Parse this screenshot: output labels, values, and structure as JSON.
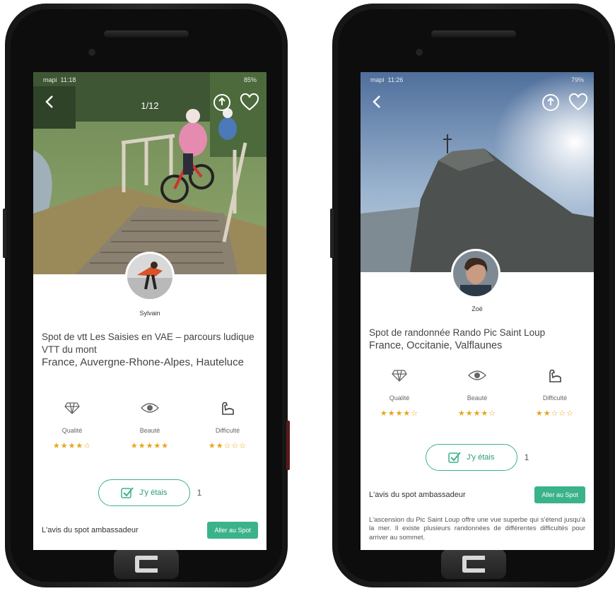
{
  "colors": {
    "accent": "#3bb38a",
    "star": "#e6a619",
    "text": "#444444"
  },
  "left": {
    "status": {
      "carrier": "mapi",
      "time": "11:18",
      "battery": "85%"
    },
    "photo_counter": "1/12",
    "author": "Sylvain",
    "title_line1": "Spot de vtt Les Saisies en VAE – parcours ludique VTT du mont",
    "title_line2": "France, Auvergne-Rhone-Alpes, Hauteluce",
    "ratings": [
      {
        "label": "Qualité",
        "stars": "★★★★☆",
        "value": 4,
        "icon": "diamond-icon"
      },
      {
        "label": "Beauté",
        "stars": "★★★★★",
        "value": 5,
        "icon": "eye-icon"
      },
      {
        "label": "Difficulté",
        "stars": "★★☆☆☆",
        "value": 2,
        "icon": "muscle-icon"
      }
    ],
    "been_label": "J'y étais",
    "been_count": "1",
    "ambassador_label": "L'avis du spot ambassadeur",
    "go_label": "Aller au Spot"
  },
  "right": {
    "status": {
      "carrier": "mapi",
      "time": "11:26",
      "battery": "79%"
    },
    "author": "Zoé",
    "title_line1": "Spot de randonnée Rando Pic Saint Loup",
    "title_line2": "France, Occitanie, Valflaunes",
    "ratings": [
      {
        "label": "Qualité",
        "stars": "★★★★☆",
        "value": 4,
        "icon": "diamond-icon"
      },
      {
        "label": "Beauté",
        "stars": "★★★★☆",
        "value": 4,
        "icon": "eye-icon"
      },
      {
        "label": "Difficulté",
        "stars": "★★☆☆☆",
        "value": 2,
        "icon": "muscle-icon"
      }
    ],
    "been_label": "J'y étais",
    "been_count": "1",
    "ambassador_label": "L'avis du spot ambassadeur",
    "go_label": "Aller au Spot",
    "ambassador_text": "L'ascension du Pic Saint Loup offre une vue superbe qui s'étend jusqu'à la mer. Il existe plusieurs randonnées de différentes difficultés pour arriver au sommet."
  }
}
